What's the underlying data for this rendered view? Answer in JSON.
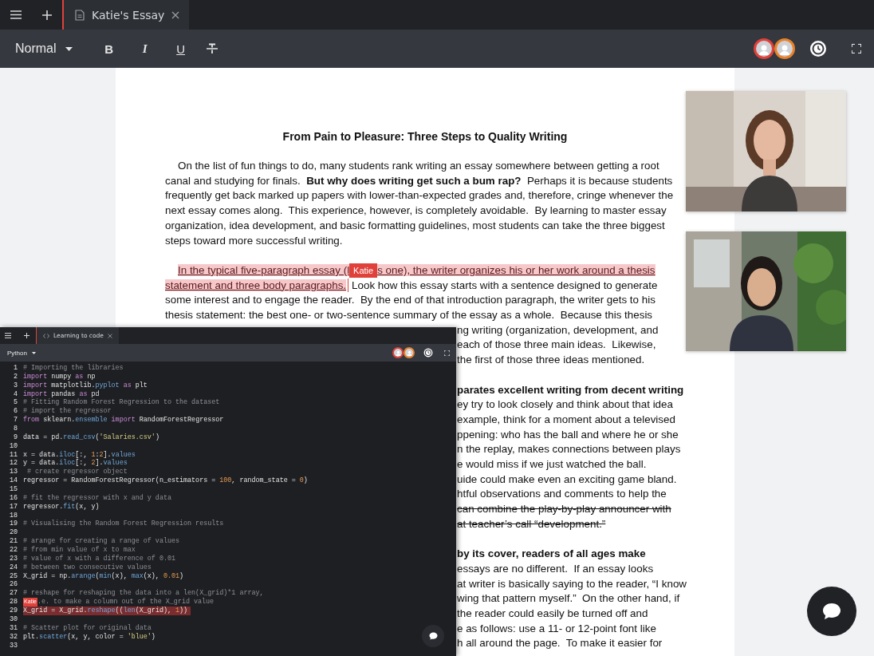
{
  "tab_bar": {
    "tab": "Katie's Essay"
  },
  "toolbar": {
    "style": "Normal",
    "format_buttons": [
      "B",
      "I",
      "U"
    ],
    "collaborators": [
      {
        "color": "#e0413a"
      },
      {
        "color": "#e8822a"
      }
    ]
  },
  "document": {
    "title": "From Pain to Pleasure: Three Steps to Quality Writing",
    "paragraphs": [
      {
        "lines": [
          {
            "segments": [
              {
                "kind": "text",
                "text": "On the list of fun things to do, many students rank writing an essay somewhere between getting a root"
              }
            ]
          },
          {
            "segments": [
              {
                "kind": "text",
                "text": "canal and studying for finals.  "
              },
              {
                "kind": "bold",
                "text": "But why does writing get such a bum rap?"
              },
              {
                "kind": "text",
                "text": "  Perhaps it is because students"
              }
            ]
          },
          {
            "segments": [
              {
                "kind": "text",
                "text": "frequently get back marked up papers with lower-than-expected grades and, therefore, cringe whenever the"
              }
            ]
          },
          {
            "segments": [
              {
                "kind": "text",
                "text": "next essay comes along.  This experience, however, is completely avoidable.  By learning to master essay"
              }
            ]
          },
          {
            "segments": [
              {
                "kind": "text",
                "text": "organization, idea development, and basic formatting guidelines, most students can take the three biggest"
              }
            ]
          },
          {
            "segments": [
              {
                "kind": "text",
                "text": "steps toward more successful writing."
              }
            ]
          }
        ]
      },
      {
        "lines": [
          {
            "segments": [
              {
                "kind": "mark",
                "text": "In the typical five-paragraph essay (l"
              },
              {
                "kind": "cursor",
                "text": "Katie"
              },
              {
                "kind": "mark",
                "text": "s one), the writer organizes his or her work around a thesis"
              }
            ]
          },
          {
            "segments": [
              {
                "kind": "mark",
                "text": "statement and three body paragraphs."
              },
              {
                "kind": "caret"
              },
              {
                "kind": "text",
                "text": "Look how this essay starts with a sentence designed to generate"
              }
            ]
          },
          {
            "segments": [
              {
                "kind": "text",
                "text": "some interest and to engage the reader.  By the end of that introduction paragraph, the writer gets to his"
              }
            ]
          },
          {
            "segments": [
              {
                "kind": "text",
                "text": "thesis statement: the best one- or two-sentence summary of the essay as a whole.  Because this thesis"
              }
            ]
          }
        ],
        "covered_lines": [
          {
            "segments": [
              {
                "kind": "text",
                "text": "ng writing (organization, development, and"
              }
            ]
          },
          {
            "segments": [
              {
                "kind": "text",
                "text": "each of those three main ideas.  Likewise,"
              }
            ]
          },
          {
            "segments": [
              {
                "kind": "text",
                "text": "the first of those three ideas mentioned."
              }
            ]
          }
        ]
      },
      {
        "covered_lines": [
          {
            "segments": [
              {
                "kind": "bold",
                "text": "parates excellent writing from decent writing"
              }
            ]
          },
          {
            "segments": [
              {
                "kind": "text",
                "text": "ey try to look closely and think about that idea"
              }
            ]
          },
          {
            "segments": [
              {
                "kind": "text",
                "text": "example, think for a moment about a televised"
              }
            ]
          },
          {
            "segments": [
              {
                "kind": "text",
                "text": "ppening: who has the ball and where he or she"
              }
            ]
          },
          {
            "segments": [
              {
                "kind": "text",
                "text": "n the replay, makes connections between plays"
              }
            ]
          },
          {
            "segments": [
              {
                "kind": "text",
                "text": "e would miss if we just watched the ball."
              }
            ]
          },
          {
            "segments": [
              {
                "kind": "text",
                "text": "uide could make even an exciting game bland."
              }
            ]
          },
          {
            "segments": [
              {
                "kind": "text",
                "text": "htful observations and comments to help the"
              }
            ]
          },
          {
            "segments": [
              {
                "kind": "strike",
                "text": "can combine the play-by-play announcer with"
              }
            ]
          },
          {
            "segments": [
              {
                "kind": "strike",
                "text": "at teacher’s call “development.”"
              }
            ]
          }
        ]
      },
      {
        "covered_lines": [
          {
            "segments": [
              {
                "kind": "bold",
                "text": "by its cover, readers of all ages make"
              }
            ]
          },
          {
            "segments": [
              {
                "kind": "text",
                "text": "essays are no different.  If an essay looks"
              }
            ]
          },
          {
            "segments": [
              {
                "kind": "text",
                "text": "at writer is basically saying to the reader, “I know"
              }
            ]
          },
          {
            "segments": [
              {
                "kind": "text",
                "text": "wing that pattern myself.”  On the other hand, if"
              }
            ]
          },
          {
            "segments": [
              {
                "kind": "text",
                "text": "the reader could easily be turned off and"
              }
            ]
          },
          {
            "segments": [
              {
                "kind": "text",
                "text": "e as follows: use a 11- or 12-point font like"
              }
            ]
          },
          {
            "segments": [
              {
                "kind": "text",
                "text": "h all around the page.  To make it easier for"
              }
            ]
          }
        ]
      }
    ]
  },
  "code_window": {
    "tab": "Learning to code",
    "language": "Python",
    "collaborators": [
      {
        "color": "#e0413a"
      },
      {
        "color": "#e8822a"
      }
    ],
    "lines": [
      {
        "number": "1",
        "highlight": false,
        "segments": [
          {
            "kind": "comment",
            "text": "# Importing the libraries"
          }
        ]
      },
      {
        "number": "2",
        "highlight": false,
        "segments": [
          {
            "kind": "keyword",
            "text": "import"
          },
          {
            "kind": "plain",
            "text": " numpy "
          },
          {
            "kind": "keyword",
            "text": "as"
          },
          {
            "kind": "plain",
            "text": " np"
          }
        ]
      },
      {
        "number": "3",
        "highlight": false,
        "segments": [
          {
            "kind": "keyword",
            "text": "import"
          },
          {
            "kind": "plain",
            "text": " matplotlib."
          },
          {
            "kind": "function",
            "text": "pyplot"
          },
          {
            "kind": "keyword",
            "text": " as"
          },
          {
            "kind": "plain",
            "text": " plt"
          }
        ]
      },
      {
        "number": "4",
        "highlight": false,
        "segments": [
          {
            "kind": "keyword",
            "text": "import"
          },
          {
            "kind": "plain",
            "text": " pandas "
          },
          {
            "kind": "keyword",
            "text": "as"
          },
          {
            "kind": "plain",
            "text": " pd"
          }
        ]
      },
      {
        "number": "5",
        "highlight": false,
        "segments": [
          {
            "kind": "comment",
            "text": "# Fitting Random Forest Regression to the dataset"
          }
        ]
      },
      {
        "number": "6",
        "highlight": false,
        "segments": [
          {
            "kind": "comment",
            "text": "# import the regressor"
          }
        ]
      },
      {
        "number": "7",
        "highlight": false,
        "segments": [
          {
            "kind": "keyword",
            "text": "from"
          },
          {
            "kind": "plain",
            "text": " sklearn."
          },
          {
            "kind": "function",
            "text": "ensemble"
          },
          {
            "kind": "keyword",
            "text": " import"
          },
          {
            "kind": "plain",
            "text": " RandomForestRegressor"
          }
        ]
      },
      {
        "number": "8",
        "highlight": false
      },
      {
        "number": "9",
        "highlight": false,
        "segments": [
          {
            "kind": "plain",
            "text": "data = pd."
          },
          {
            "kind": "function",
            "text": "read_csv"
          },
          {
            "kind": "plain",
            "text": "("
          },
          {
            "kind": "string",
            "text": "'Salaries.csv'"
          },
          {
            "kind": "plain",
            "text": ")"
          }
        ]
      },
      {
        "number": "10",
        "highlight": false
      },
      {
        "number": "11",
        "highlight": false,
        "segments": [
          {
            "kind": "plain",
            "text": "x = data."
          },
          {
            "kind": "function",
            "text": "iloc"
          },
          {
            "kind": "plain",
            "text": "[:, "
          },
          {
            "kind": "number",
            "text": "1"
          },
          {
            "kind": "plain",
            "text": ":"
          },
          {
            "kind": "number",
            "text": "2"
          },
          {
            "kind": "plain",
            "text": "]."
          },
          {
            "kind": "function",
            "text": "values"
          }
        ]
      },
      {
        "number": "12",
        "highlight": false,
        "segments": [
          {
            "kind": "plain",
            "text": "y = data."
          },
          {
            "kind": "function",
            "text": "iloc"
          },
          {
            "kind": "plain",
            "text": "[:, "
          },
          {
            "kind": "number",
            "text": "2"
          },
          {
            "kind": "plain",
            "text": "]."
          },
          {
            "kind": "function",
            "text": "values"
          }
        ]
      },
      {
        "number": "13",
        "highlight": false,
        "segments": [
          {
            "kind": "comment",
            "text": " # create regressor object"
          }
        ]
      },
      {
        "number": "14",
        "highlight": false,
        "segments": [
          {
            "kind": "plain",
            "text": "regressor = RandomForestRegressor(n_estimators = "
          },
          {
            "kind": "number",
            "text": "100"
          },
          {
            "kind": "plain",
            "text": ", random_state = "
          },
          {
            "kind": "number",
            "text": "0"
          },
          {
            "kind": "plain",
            "text": ")"
          }
        ]
      },
      {
        "number": "15",
        "highlight": false
      },
      {
        "number": "16",
        "highlight": false,
        "segments": [
          {
            "kind": "comment",
            "text": "# fit the regressor with x and y data"
          }
        ]
      },
      {
        "number": "17",
        "highlight": false,
        "segments": [
          {
            "kind": "plain",
            "text": "regressor."
          },
          {
            "kind": "function",
            "text": "fit"
          },
          {
            "kind": "plain",
            "text": "(x, y)"
          }
        ]
      },
      {
        "number": "18",
        "highlight": false
      },
      {
        "number": "19",
        "highlight": false,
        "segments": [
          {
            "kind": "comment",
            "text": "# Visualising the Random Forest Regression results"
          }
        ]
      },
      {
        "number": "20",
        "highlight": false
      },
      {
        "number": "21",
        "highlight": false,
        "segments": [
          {
            "kind": "comment",
            "text": "# arange for creating a range of values"
          }
        ]
      },
      {
        "number": "22",
        "highlight": false,
        "segments": [
          {
            "kind": "comment",
            "text": "# from min value of x to max"
          }
        ]
      },
      {
        "number": "23",
        "highlight": false,
        "segments": [
          {
            "kind": "comment",
            "text": "# value of x with a difference of 0.01"
          }
        ]
      },
      {
        "number": "24",
        "highlight": false,
        "segments": [
          {
            "kind": "comment",
            "text": "# between two consecutive values"
          }
        ]
      },
      {
        "number": "25",
        "highlight": false,
        "segments": [
          {
            "kind": "plain",
            "text": "X_grid = np."
          },
          {
            "kind": "function",
            "text": "arange"
          },
          {
            "kind": "plain",
            "text": "("
          },
          {
            "kind": "function",
            "text": "min"
          },
          {
            "kind": "plain",
            "text": "(x), "
          },
          {
            "kind": "function",
            "text": "max"
          },
          {
            "kind": "plain",
            "text": "(x), "
          },
          {
            "kind": "number",
            "text": "0.01"
          },
          {
            "kind": "plain",
            "text": ")"
          }
        ]
      },
      {
        "number": "26",
        "highlight": false
      },
      {
        "number": "27",
        "highlight": false,
        "segments": [
          {
            "kind": "comment",
            "text": "# reshape for reshaping the data into a len(X_grid)*1 array,"
          }
        ]
      },
      {
        "number": "28",
        "highlight": false,
        "segments": [
          {
            "kind": "cursor",
            "text": "Katie"
          },
          {
            "kind": "comment",
            "text": ".e. to make a column out of the X_grid value"
          }
        ]
      },
      {
        "number": "29",
        "highlight": true,
        "segments": [
          {
            "kind": "plain",
            "text": "X_grid = X_grid."
          },
          {
            "kind": "function",
            "text": "reshape"
          },
          {
            "kind": "plain",
            "text": "(("
          },
          {
            "kind": "function",
            "text": "len"
          },
          {
            "kind": "plain",
            "text": "(X_grid), "
          },
          {
            "kind": "number",
            "text": "1"
          },
          {
            "kind": "plain",
            "text": "))"
          }
        ]
      },
      {
        "number": "30",
        "highlight": false
      },
      {
        "number": "31",
        "highlight": false,
        "segments": [
          {
            "kind": "comment",
            "text": "# Scatter plot for original data"
          }
        ]
      },
      {
        "number": "32",
        "highlight": false,
        "segments": [
          {
            "kind": "plain",
            "text": "plt."
          },
          {
            "kind": "function",
            "text": "scatter"
          },
          {
            "kind": "plain",
            "text": "(x, y, color = "
          },
          {
            "kind": "string",
            "text": "'blue'"
          },
          {
            "kind": "plain",
            "text": ")"
          }
        ]
      },
      {
        "number": "33",
        "highlight": false
      }
    ]
  }
}
